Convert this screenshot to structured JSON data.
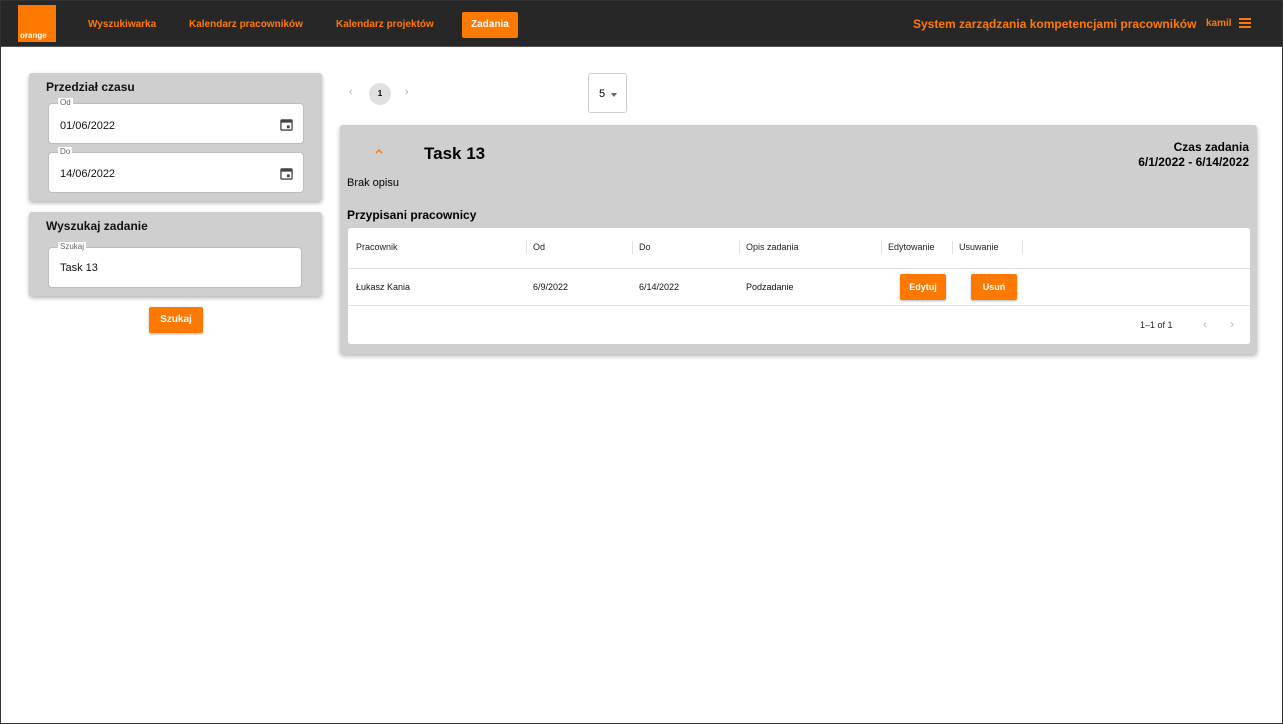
{
  "header": {
    "logo_text": "orange",
    "nav": [
      {
        "label": "Wyszukiwarka"
      },
      {
        "label": "Kalendarz pracowników"
      },
      {
        "label": "Kalendarz projektów"
      },
      {
        "label": "Zadania"
      }
    ],
    "app_title": "System zarządzania kompetencjami pracowników",
    "user": "kamil",
    "accent": "#ff7900",
    "bar_color": "#272727"
  },
  "sidebar": {
    "time_range": {
      "title": "Przedział czasu",
      "from_label": "Od",
      "from_value": "01/06/2022",
      "to_label": "Do",
      "to_value": "14/06/2022",
      "icon": "calendar-icon"
    },
    "search": {
      "title": "Wyszukaj zadanie",
      "field_label": "Szukaj",
      "field_value": "Task 13",
      "button_label": "Szukaj"
    }
  },
  "pagination_top": {
    "page": "1",
    "page_size": "5"
  },
  "task": {
    "title": "Task 13",
    "time_label": "Czas zadania",
    "time_value": "6/1/2022 - 6/14/2022",
    "description": "Brak opisu",
    "assigned_title": "Przypisani pracownicy",
    "columns": [
      "Pracownik",
      "Od",
      "Do",
      "Opis zadania",
      "Edytowanie",
      "Usuwanie"
    ],
    "rows": [
      {
        "employee": "Łukasz Kania",
        "from": "6/9/2022",
        "to": "6/14/2022",
        "description": "Podzadanie",
        "edit_label": "Edytuj",
        "delete_label": "Usuń"
      }
    ],
    "footer_count": "1–1 of 1"
  }
}
